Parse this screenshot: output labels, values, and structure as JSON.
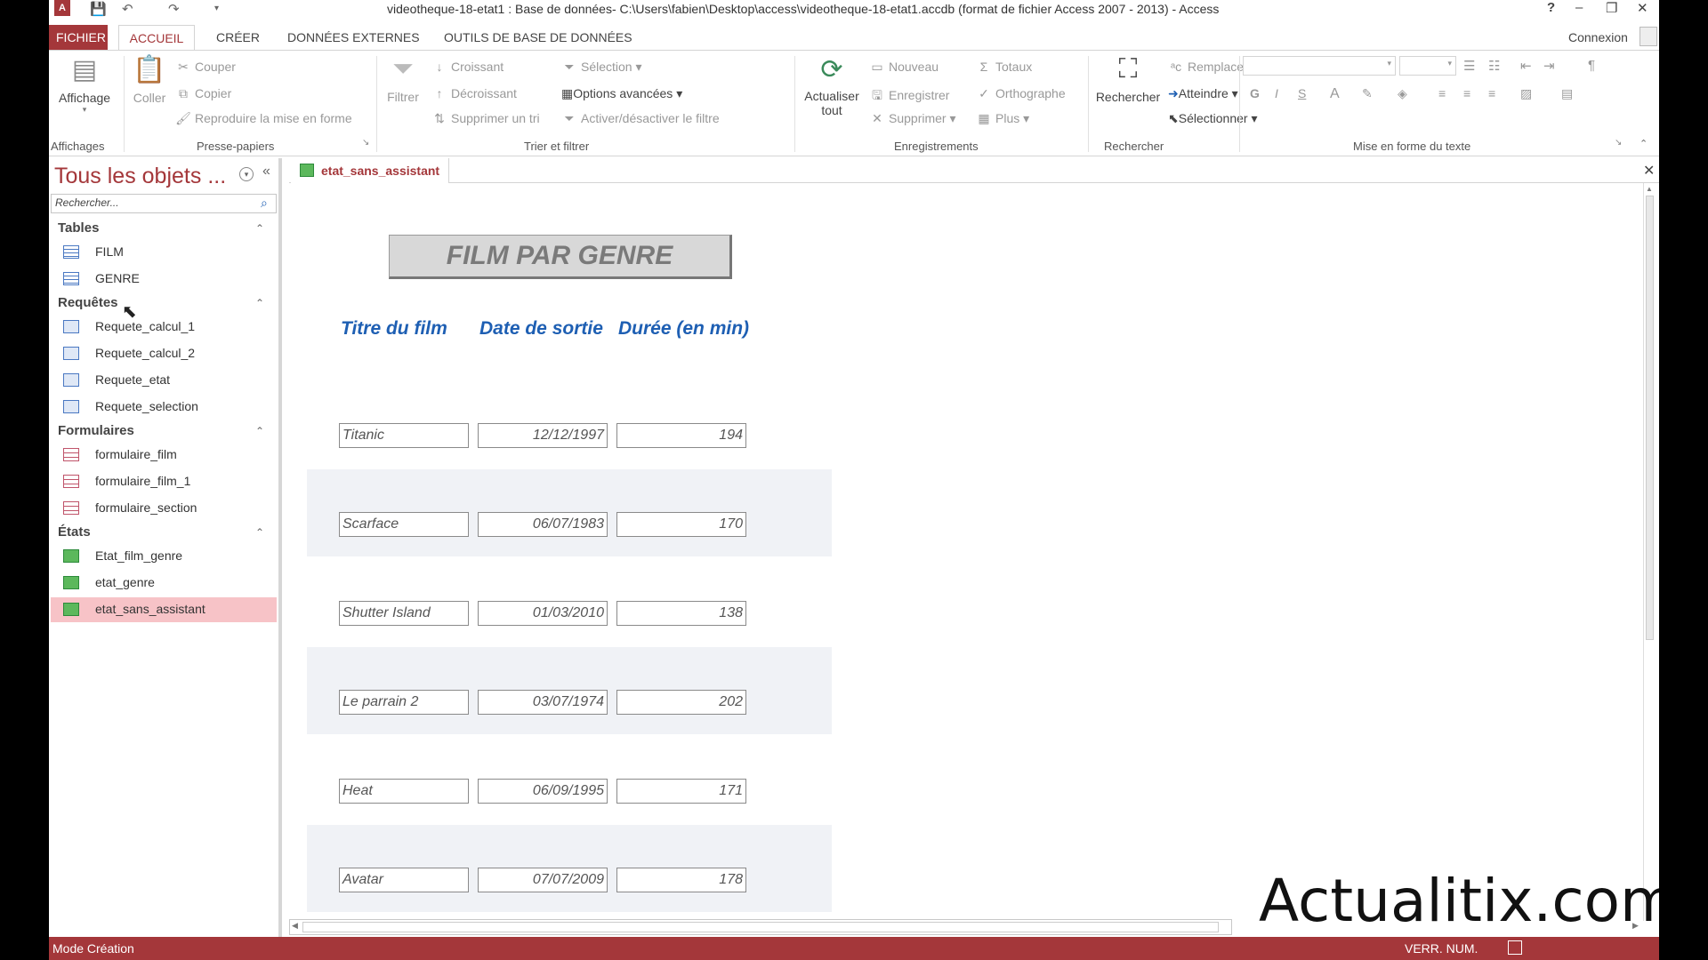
{
  "window": {
    "title": "videotheque-18-etat1 : Base de données- C:\\Users\\fabien\\Desktop\\access\\videotheque-18-etat1.accdb (format de fichier Access 2007 - 2013) - Access",
    "help": "?",
    "minimize": "–",
    "restore": "❐",
    "close": "✕",
    "account": "Connexion"
  },
  "tabs": [
    "FICHIER",
    "ACCUEIL",
    "CRÉER",
    "DONNÉES EXTERNES",
    "OUTILS DE BASE DE DONNÉES"
  ],
  "ribbon": {
    "affichage": "Affichage",
    "coller": "Coller",
    "couper": "Couper",
    "copier": "Copier",
    "reproduire": "Reproduire la mise en forme",
    "filtrer": "Filtrer",
    "croissant": "Croissant",
    "decroissant": "Décroissant",
    "supprimer_tri": "Supprimer un tri",
    "selection": "Sélection",
    "options_avancees": "Options avancées",
    "activer_filtre": "Activer/désactiver le filtre",
    "actualiser": "Actualiser",
    "tout": "tout",
    "nouveau": "Nouveau",
    "enregistrer": "Enregistrer",
    "supprimer": "Supprimer",
    "totaux": "Totaux",
    "orthographe": "Orthographe",
    "plus": "Plus",
    "rechercher": "Rechercher",
    "remplacer": "Remplacer",
    "atteindre": "Atteindre",
    "selectionner": "Sélectionner",
    "bold": "G",
    "italic": "I",
    "underline": "S",
    "fontcolor": "A",
    "groups": {
      "affichages": "Affichages",
      "presse_papiers": "Presse-papiers",
      "trier_filtrer": "Trier et filtrer",
      "enregistrements": "Enregistrements",
      "rechercher": "Rechercher",
      "mise_en_forme": "Mise en forme du texte"
    }
  },
  "nav": {
    "header": "Tous les objets ...",
    "search_placeholder": "Rechercher...",
    "sections": [
      {
        "title": "Tables",
        "items": [
          "FILM",
          "GENRE"
        ]
      },
      {
        "title": "Requêtes",
        "items": [
          "Requete_calcul_1",
          "Requete_calcul_2",
          "Requete_etat",
          "Requete_selection"
        ]
      },
      {
        "title": "Formulaires",
        "items": [
          "formulaire_film",
          "formulaire_film_1",
          "formulaire_section"
        ]
      },
      {
        "title": "États",
        "items": [
          "Etat_film_genre",
          "etat_genre",
          "etat_sans_assistant"
        ]
      }
    ]
  },
  "document": {
    "tab": "etat_sans_assistant",
    "report_title": "FILM PAR GENRE",
    "columns": [
      "Titre du film",
      "Date de sortie",
      "Durée (en min)"
    ],
    "rows": [
      [
        "Titanic",
        "12/12/1997",
        "194"
      ],
      [
        "Scarface",
        "06/07/1983",
        "170"
      ],
      [
        "Shutter Island",
        "01/03/2010",
        "138"
      ],
      [
        "Le parrain 2",
        "03/07/1974",
        "202"
      ],
      [
        "Heat",
        "06/09/1995",
        "171"
      ],
      [
        "Avatar",
        "07/07/2009",
        "178"
      ]
    ]
  },
  "status": {
    "mode": "Mode Création",
    "verr": "VERR. NUM."
  },
  "watermark": "Actualitix.com"
}
